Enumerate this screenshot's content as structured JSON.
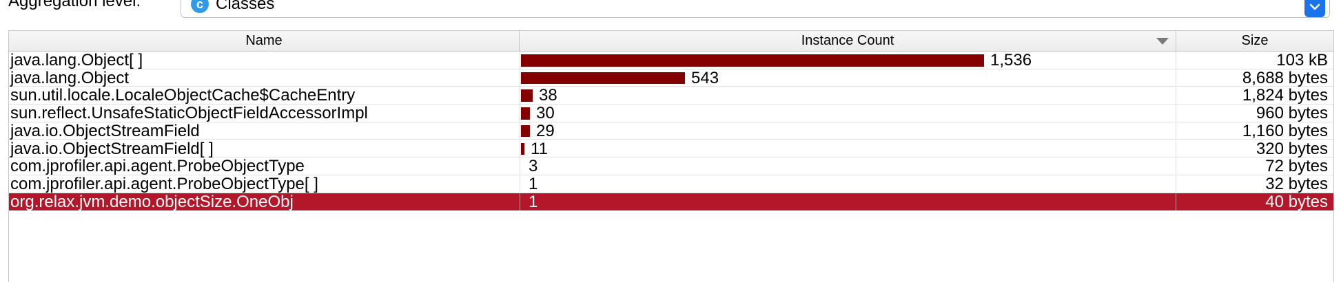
{
  "aggregation": {
    "label": "Aggregation level:",
    "selected_value": "Classes",
    "icon_letter": "c"
  },
  "table": {
    "columns": {
      "name": "Name",
      "instance_count": "Instance Count",
      "size": "Size"
    },
    "sort": {
      "column": "instance_count",
      "direction": "descending"
    },
    "max_count": 1536,
    "colors": {
      "bar": "#840000",
      "selected_row": "#b5172a"
    },
    "rows": [
      {
        "name": "java.lang.Object[ ]",
        "count": 1536,
        "count_label": "1,536",
        "size": "103 kB",
        "selected": false
      },
      {
        "name": "java.lang.Object",
        "count": 543,
        "count_label": "543",
        "size": "8,688 bytes",
        "selected": false
      },
      {
        "name": "sun.util.locale.LocaleObjectCache$CacheEntry",
        "count": 38,
        "count_label": "38",
        "size": "1,824 bytes",
        "selected": false
      },
      {
        "name": "sun.reflect.UnsafeStaticObjectFieldAccessorImpl",
        "count": 30,
        "count_label": "30",
        "size": "960 bytes",
        "selected": false
      },
      {
        "name": "java.io.ObjectStreamField",
        "count": 29,
        "count_label": "29",
        "size": "1,160 bytes",
        "selected": false
      },
      {
        "name": "java.io.ObjectStreamField[ ]",
        "count": 11,
        "count_label": "11",
        "size": "320 bytes",
        "selected": false
      },
      {
        "name": "com.jprofiler.api.agent.ProbeObjectType",
        "count": 3,
        "count_label": "3",
        "size": "72 bytes",
        "selected": false
      },
      {
        "name": "com.jprofiler.api.agent.ProbeObjectType[ ]",
        "count": 1,
        "count_label": "1",
        "size": "32 bytes",
        "selected": false
      },
      {
        "name": "org.relax.jvm.demo.objectSize.OneObj",
        "count": 1,
        "count_label": "1",
        "size": "40 bytes",
        "selected": true
      }
    ]
  }
}
